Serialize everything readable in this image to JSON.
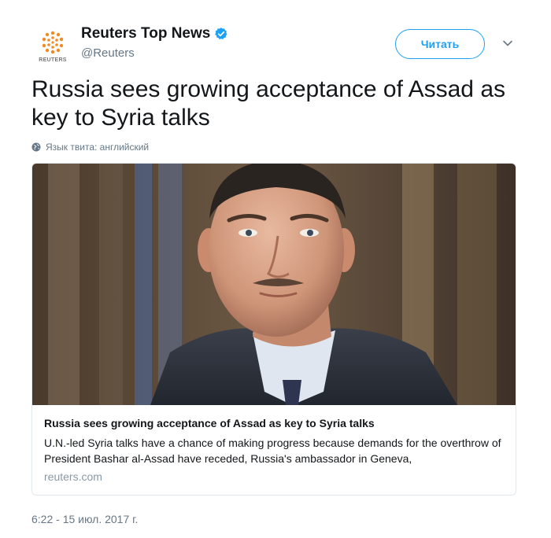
{
  "author": {
    "display_name": "Reuters Top News",
    "handle": "@Reuters",
    "avatar_label": "REUTERS",
    "verified": true,
    "verified_icon": "verified-badge-icon"
  },
  "follow_button": {
    "label": "Читать"
  },
  "tweet": {
    "text": "Russia sees growing acceptance of Assad as key to Syria talks",
    "language_label": "Язык твита: английский",
    "timestamp": "6:22 - 15 июл. 2017 г."
  },
  "card": {
    "title": "Russia sees growing acceptance of Assad as key to Syria talks",
    "description": "U.N.-led Syria talks have a chance of making progress because demands for the overthrow of President Bashar al-Assad have receded, Russia's ambassador in Geneva,",
    "domain": "reuters.com"
  },
  "colors": {
    "accent": "#1da1f2",
    "text": "#14171a",
    "muted": "#657786",
    "reuters_orange": "#f08a24"
  }
}
